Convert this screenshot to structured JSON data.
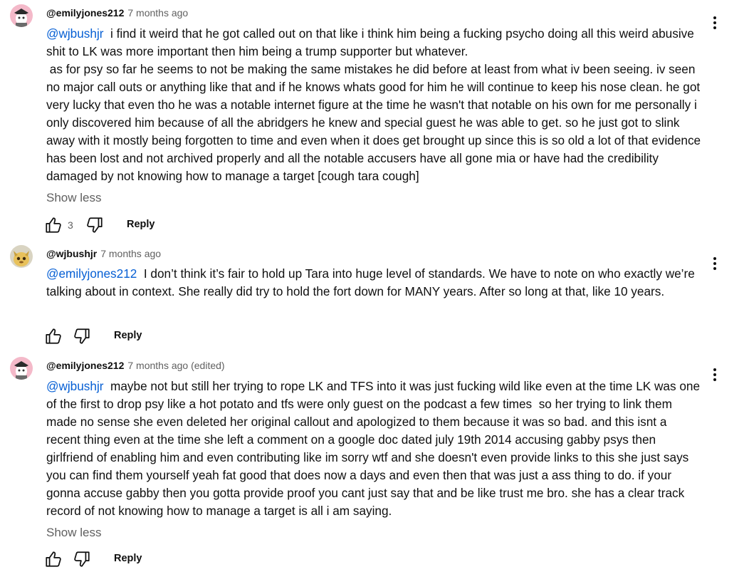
{
  "comments": [
    {
      "author": "@emilyjones212",
      "time": "7 months ago",
      "mention": "@wjbushjr",
      "text_first": "  i find it weird that he got called out on that like i think him being a fucking psycho doing all this weird abusive shit to LK was more important then him being a trump supporter but whatever.",
      "text_rest": " as for psy so far he seems to not be making the same mistakes he did before at least from what iv been seeing. iv seen no major call outs or anything like that and if he knows whats good for him he will continue to keep his nose clean. he got very lucky that even tho he was a notable internet figure at the time he wasn't that notable on his own for me personally i only discovered him because of all the abridgers he knew and special guest he was able to get. so he just got to slink away with it mostly being forgotten to time and even when it does get brought up since this is so old a lot of that evidence has been lost and not archived properly and all the notable accusers have all gone mia or have had the credibility damaged by not knowing how to manage a target [cough tara cough]",
      "show_less": "Show less",
      "likes": "3",
      "reply_label": "Reply"
    },
    {
      "author": "@wjbushjr",
      "time": "7 months ago",
      "mention": "@emilyjones212",
      "text_first": "  I don’t think it’s fair to hold up Tara into huge level of standards. We have to note on who exactly we’re talking about in context. She really did try to hold the fort down for MANY years. After so long at that, like 10 years.",
      "reply_label": "Reply"
    },
    {
      "author": "@emilyjones212",
      "time": "7 months ago (edited)",
      "mention": "@wjbushjr",
      "text_first": "  maybe not but still her trying to rope LK and TFS into it was just fucking wild like even at the time LK was one of the first to drop psy like a hot potato and tfs were only guest on the podcast a few times  so her trying to link them made no sense she even deleted her original callout and apologized to them because it was so bad. and this isnt a recent thing even at the time she left a comment on a google doc dated july 19th 2014 accusing gabby psys then girlfriend of enabling him and even contributing like im sorry wtf and she doesn't even provide links to this she just says you can find them yourself yeah fat good that does now a days and even then that was just a ass thing to do. if your gonna accuse gabby then you gotta provide proof you cant just say that and be like trust me bro. she has a clear track record of not knowing how to manage a target is all i am saying.",
      "show_less": "Show less",
      "reply_label": "Reply"
    }
  ],
  "icons": {
    "like": "thumbs-up-icon",
    "dislike": "thumbs-down-icon",
    "menu": "more-vert-icon"
  },
  "colors": {
    "mention": "#065fd4",
    "secondary_text": "#606060",
    "primary_text": "#0f0f0f"
  }
}
